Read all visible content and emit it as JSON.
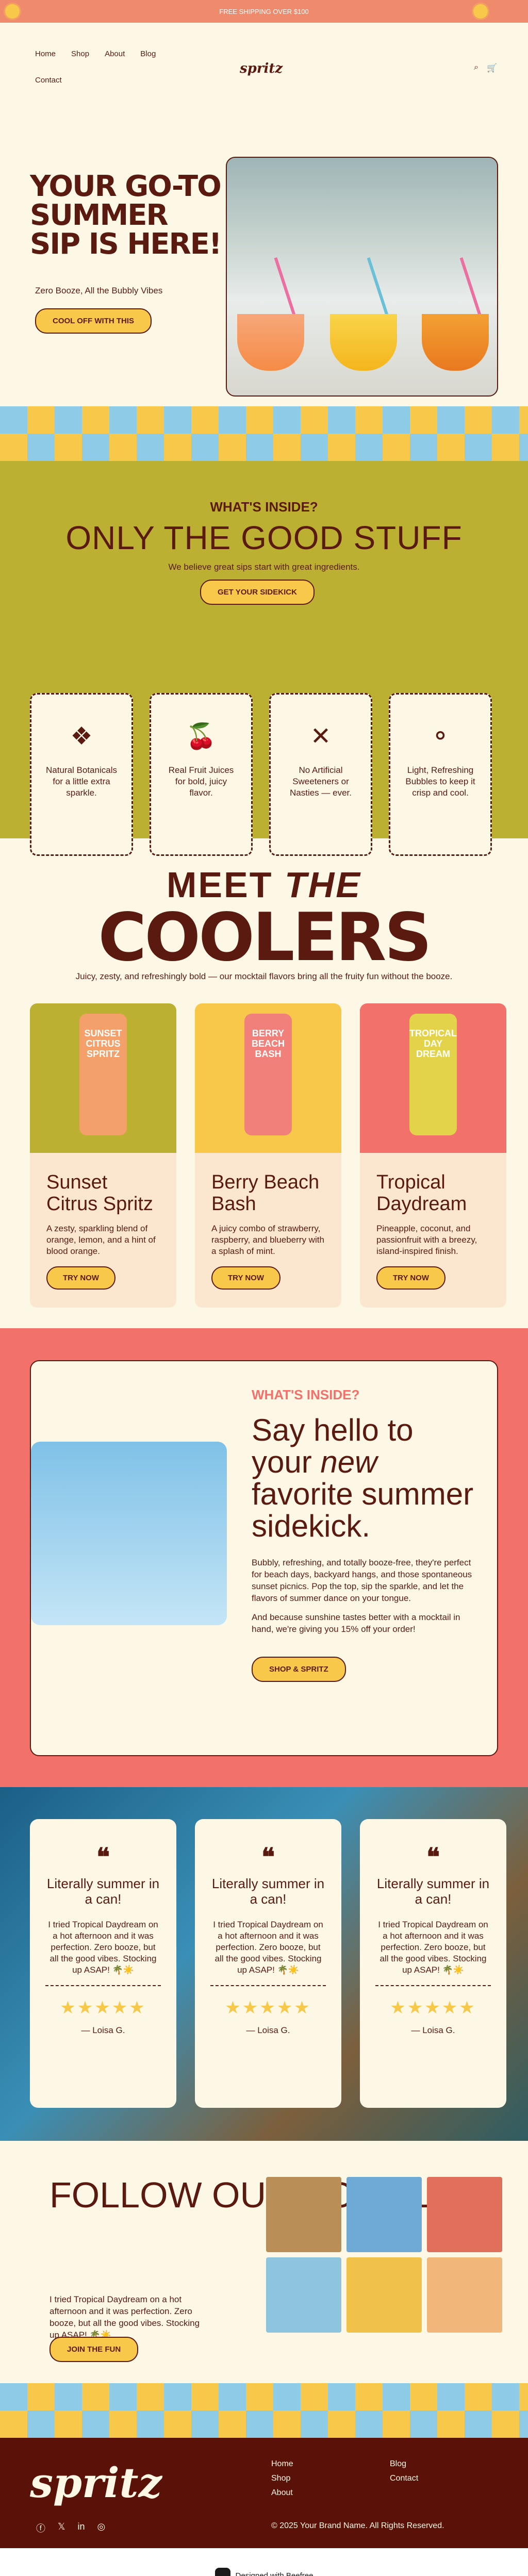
{
  "topbar": {
    "text": "FREE SHIPPING OVER $100"
  },
  "header": {
    "nav": [
      "Home",
      "Shop",
      "About",
      "Blog",
      "Contact"
    ],
    "logo": "spritz"
  },
  "hero": {
    "title": "YOUR GO-TO SUMMER SIP IS HERE!",
    "subtitle": "Zero Booze, All the Bubbly Vibes",
    "cta": "COOL OFF WITH THIS"
  },
  "inside": {
    "eyebrow": "WHAT'S INSIDE?",
    "heading": "ONLY THE GOOD STUFF",
    "desc": "We believe great sips start with great ingredients.",
    "cta": "GET YOUR SIDEKICK",
    "cards": [
      {
        "icon": "botanical-icon",
        "glyph": "❖",
        "text": "Natural Botanicals for a little extra sparkle."
      },
      {
        "icon": "fruit-icon",
        "glyph": "🍒",
        "text": "Real Fruit Juices for bold, juicy flavor."
      },
      {
        "icon": "no-artificial-icon",
        "glyph": "✕",
        "text": "No Artificial Sweeteners or Nasties — ever."
      },
      {
        "icon": "bubbles-icon",
        "glyph": "⚬",
        "text": "Light, Refreshing Bubbles to keep it crisp and cool."
      }
    ]
  },
  "coolers": {
    "meet": "MEET",
    "the": "THE",
    "word": "COOLERS",
    "desc": "Juicy, zesty, and refreshingly bold — our mocktail flavors bring all the fruity fun without the booze.",
    "products": [
      {
        "name": "Sunset Citrus Spritz",
        "can": "SUNSET CITRUS SPRITZ",
        "desc": "A zesty, sparkling blend of orange, lemon, and a hint of blood orange.",
        "cta": "TRY NOW",
        "bg": "#bcb032",
        "can_color": "#f4a06a"
      },
      {
        "name": "Berry Beach Bash",
        "can": "BERRY BEACH BASH",
        "desc": "A juicy combo of strawberry, raspberry, and blueberry with a splash of mint.",
        "cta": "TRY NOW",
        "bg": "#f7c84a",
        "can_color": "#f1807a"
      },
      {
        "name": "Tropical Daydream",
        "can": "TROPICAL DAY DREAM",
        "desc": "Pineapple, coconut, and passionfruit with a breezy, island-inspired finish.",
        "cta": "TRY NOW",
        "bg": "#f2716a",
        "can_color": "#e3d34a"
      }
    ]
  },
  "sidekick": {
    "eyebrow": "WHAT'S INSIDE?",
    "heading_pre": "Say hello to your",
    "heading_em": "new",
    "heading_post": "favorite summer sidekick.",
    "p1": "Bubbly, refreshing, and totally booze-free, they're perfect for beach days, backyard hangs, and those spontaneous sunset picnics. Pop the top, sip the sparkle, and let the flavors of summer dance on your tongue.",
    "p2": "And because sunshine tastes better with a mocktail in hand, we're giving you 15% off your order!",
    "cta": "SHOP & SPRITZ"
  },
  "testimonials": [
    {
      "quote_mark": "❝",
      "title": "Literally summer in a can!",
      "text": "I tried Tropical Daydream on a hot afternoon and it was perfection. Zero booze, but all the good vibes. Stocking up ASAP! 🌴☀️",
      "stars": "★★★★★",
      "author": "— Loisa G."
    },
    {
      "quote_mark": "❝",
      "title": "Literally summer in a can!",
      "text": "I tried Tropical Daydream on a hot afternoon and it was perfection. Zero booze, but all the good vibes. Stocking up ASAP! 🌴☀️",
      "stars": "★★★★★",
      "author": "— Loisa G."
    },
    {
      "quote_mark": "❝",
      "title": "Literally summer in a can!",
      "text": "I tried Tropical Daydream on a hot afternoon and it was perfection. Zero booze, but all the good vibes. Stocking up ASAP! 🌴☀️",
      "stars": "★★★★★",
      "author": "— Loisa G."
    }
  ],
  "socials": {
    "heading": "FOLLOW OUR SOCIALS",
    "text": "I tried Tropical Daydream on a hot afternoon and it was perfection. Zero booze, but all the good vibes. Stocking up ASAP! 🌴☀️",
    "cta": "JOIN THE FUN",
    "tiles": [
      "#b98e57",
      "#6fa9d6",
      "#e0705b",
      "#8ec4dd",
      "#f0c24a",
      "#f1b77a"
    ]
  },
  "footer": {
    "logo": "spritz",
    "links": [
      "Home",
      "Blog",
      "Shop",
      "Contact",
      "About"
    ],
    "copyright": "© 2025 Your Brand Name. All Rights Reserved.",
    "badge": "Designed with Beefree"
  }
}
